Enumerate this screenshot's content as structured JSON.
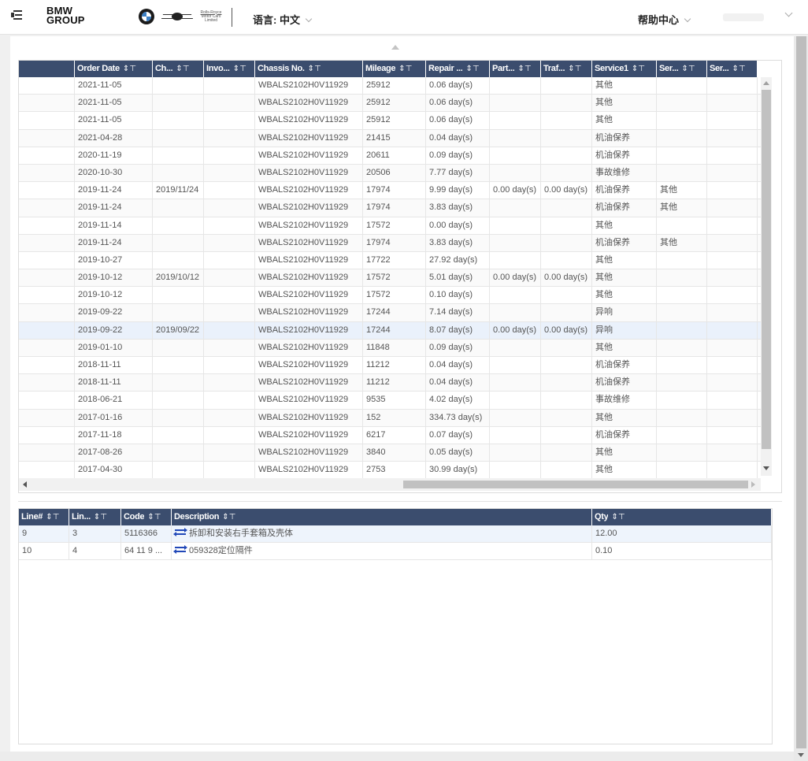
{
  "header": {
    "logo_line1": "BMW",
    "logo_line2": "GROUP",
    "brand_rr_line1": "Rolls-Royce",
    "brand_rr_line2": "Motor Cars Limited",
    "language_label": "语言: 中文",
    "help_center": "帮助中心"
  },
  "orders_table": {
    "columns": [
      "",
      "Order Date",
      "Ch...",
      "Invo...",
      "Chassis No.",
      "Mileage",
      "Repair ...",
      "Part...",
      "Traf...",
      "Service1",
      "Ser...",
      "Ser..."
    ],
    "sort_filter_icons": "⇕⊤",
    "rows": [
      [
        "",
        "2021-11-05",
        "",
        "",
        "WBALS2102H0V11929",
        "25912",
        "0.06 day(s)",
        "",
        "",
        "其他",
        "",
        ""
      ],
      [
        "",
        "2021-11-05",
        "",
        "",
        "WBALS2102H0V11929",
        "25912",
        "0.06 day(s)",
        "",
        "",
        "其他",
        "",
        ""
      ],
      [
        "",
        "2021-11-05",
        "",
        "",
        "WBALS2102H0V11929",
        "25912",
        "0.06 day(s)",
        "",
        "",
        "其他",
        "",
        ""
      ],
      [
        "",
        "2021-04-28",
        "",
        "",
        "WBALS2102H0V11929",
        "21415",
        "0.04 day(s)",
        "",
        "",
        "机油保养",
        "",
        ""
      ],
      [
        "",
        "2020-11-19",
        "",
        "",
        "WBALS2102H0V11929",
        "20611",
        "0.09 day(s)",
        "",
        "",
        "机油保养",
        "",
        ""
      ],
      [
        "",
        "2020-10-30",
        "",
        "",
        "WBALS2102H0V11929",
        "20506",
        "7.77 day(s)",
        "",
        "",
        "事故维修",
        "",
        ""
      ],
      [
        "",
        "2019-11-24",
        "2019/11/24",
        "",
        "WBALS2102H0V11929",
        "17974",
        "9.99 day(s)",
        "0.00 day(s)",
        "0.00 day(s)",
        "机油保养",
        "其他",
        ""
      ],
      [
        "",
        "2019-11-24",
        "",
        "",
        "WBALS2102H0V11929",
        "17974",
        "3.83 day(s)",
        "",
        "",
        "机油保养",
        "其他",
        ""
      ],
      [
        "",
        "2019-11-14",
        "",
        "",
        "WBALS2102H0V11929",
        "17572",
        "0.00 day(s)",
        "",
        "",
        "其他",
        "",
        ""
      ],
      [
        "",
        "2019-11-24",
        "",
        "",
        "WBALS2102H0V11929",
        "17974",
        "3.83 day(s)",
        "",
        "",
        "机油保养",
        "其他",
        ""
      ],
      [
        "",
        "2019-10-27",
        "",
        "",
        "WBALS2102H0V11929",
        "17722",
        "27.92 day(s)",
        "",
        "",
        "其他",
        "",
        ""
      ],
      [
        "",
        "2019-10-12",
        "2019/10/12",
        "",
        "WBALS2102H0V11929",
        "17572",
        "5.01 day(s)",
        "0.00 day(s)",
        "0.00 day(s)",
        "其他",
        "",
        ""
      ],
      [
        "",
        "2019-10-12",
        "",
        "",
        "WBALS2102H0V11929",
        "17572",
        "0.10 day(s)",
        "",
        "",
        "其他",
        "",
        ""
      ],
      [
        "",
        "2019-09-22",
        "",
        "",
        "WBALS2102H0V11929",
        "17244",
        "7.14 day(s)",
        "",
        "",
        "异响",
        "",
        ""
      ],
      [
        "",
        "2019-09-22",
        "2019/09/22",
        "",
        "WBALS2102H0V11929",
        "17244",
        "8.07 day(s)",
        "0.00 day(s)",
        "0.00 day(s)",
        "异响",
        "",
        ""
      ],
      [
        "",
        "2019-01-10",
        "",
        "",
        "WBALS2102H0V11929",
        "11848",
        "0.09 day(s)",
        "",
        "",
        "其他",
        "",
        ""
      ],
      [
        "",
        "2018-11-11",
        "",
        "",
        "WBALS2102H0V11929",
        "11212",
        "0.04 day(s)",
        "",
        "",
        "机油保养",
        "",
        ""
      ],
      [
        "",
        "2018-11-11",
        "",
        "",
        "WBALS2102H0V11929",
        "11212",
        "0.04 day(s)",
        "",
        "",
        "机油保养",
        "",
        ""
      ],
      [
        "",
        "2018-06-21",
        "",
        "",
        "WBALS2102H0V11929",
        "9535",
        "4.02 day(s)",
        "",
        "",
        "事故维修",
        "",
        ""
      ],
      [
        "",
        "2017-01-16",
        "",
        "",
        "WBALS2102H0V11929",
        "152",
        "334.73 day(s)",
        "",
        "",
        "其他",
        "",
        ""
      ],
      [
        "",
        "2017-11-18",
        "",
        "",
        "WBALS2102H0V11929",
        "6217",
        "0.07 day(s)",
        "",
        "",
        "机油保养",
        "",
        ""
      ],
      [
        "",
        "2017-08-26",
        "",
        "",
        "WBALS2102H0V11929",
        "3840",
        "0.05 day(s)",
        "",
        "",
        "其他",
        "",
        ""
      ],
      [
        "",
        "2017-04-30",
        "",
        "",
        "WBALS2102H0V11929",
        "2753",
        "30.99 day(s)",
        "",
        "",
        "其他",
        "",
        ""
      ]
    ],
    "highlighted_row": 14
  },
  "lines_table": {
    "columns": [
      "Line#",
      "Lin...",
      "Code",
      "Description",
      "Qty"
    ],
    "sort_filter_icons": "⇕⊤",
    "rows": [
      [
        "9",
        "3",
        "5116366",
        "拆卸和安装右手套箱及壳体",
        "12.00"
      ],
      [
        "10",
        "4",
        "64 11 9 ...",
        "059328定位隔件",
        "0.10"
      ]
    ]
  },
  "colors": {
    "header_bg": "#3b4d6e",
    "highlight_row": "#eaf1fb",
    "swap_icon": "#2148b8"
  }
}
